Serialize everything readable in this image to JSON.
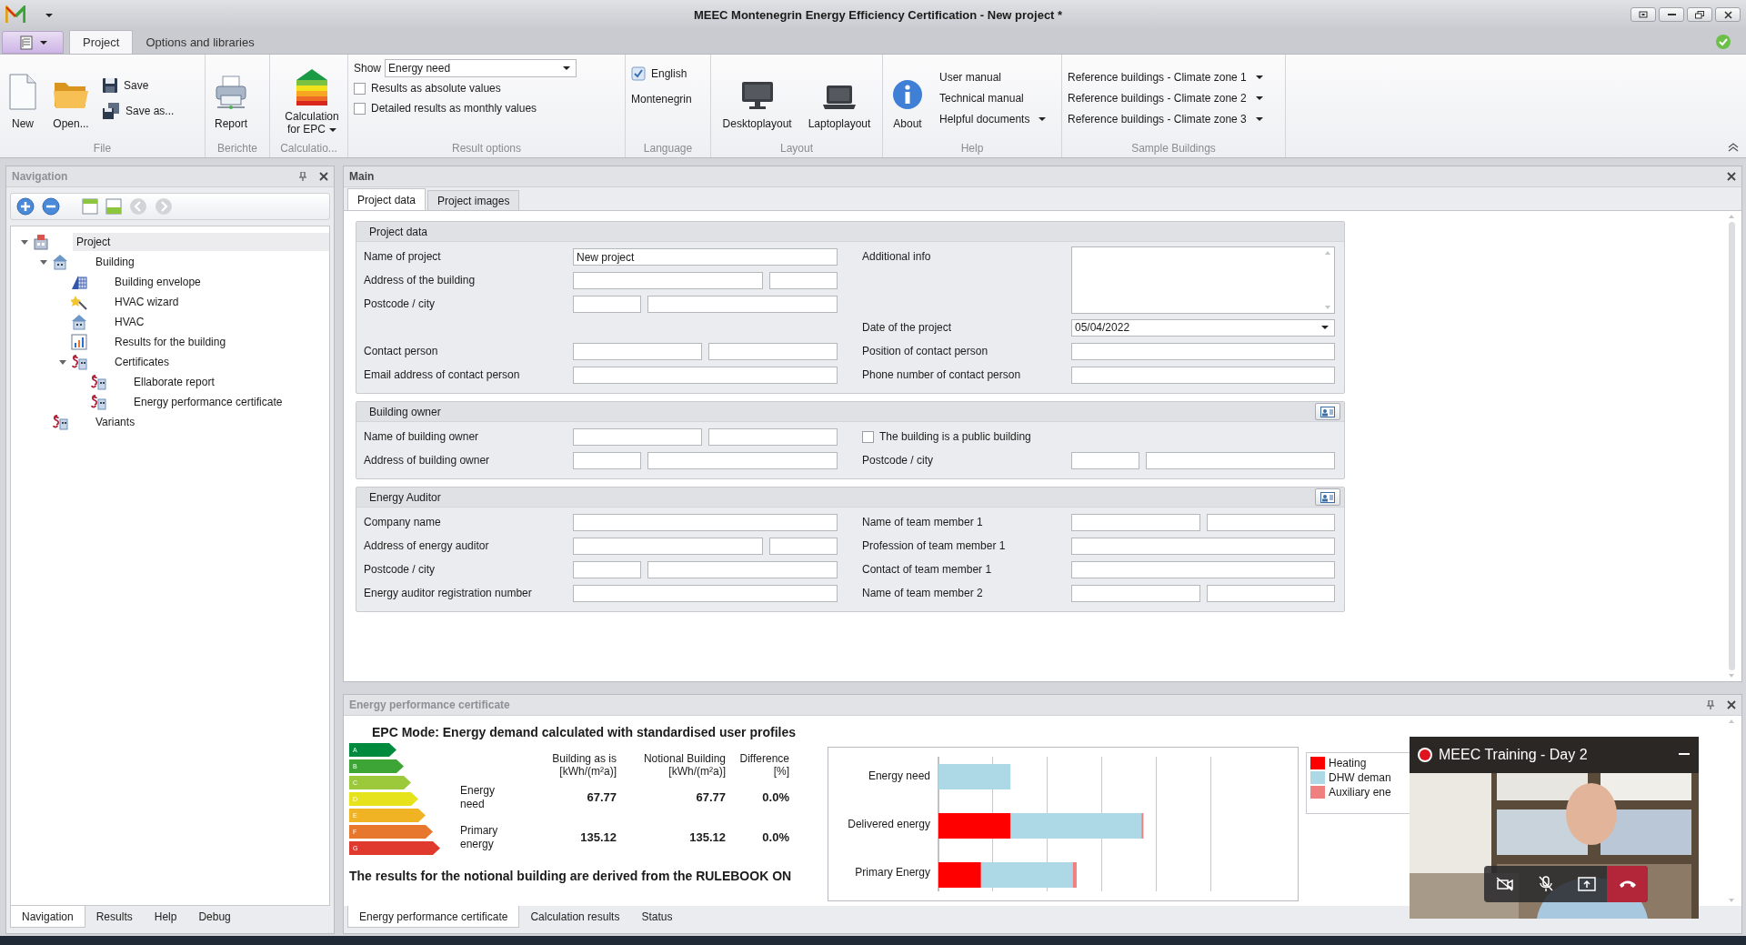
{
  "window": {
    "title": "MEEC Montenegrin Energy Efficiency Certification - New project *"
  },
  "ribbon_tabs": [
    {
      "label": "Project",
      "selected": true
    },
    {
      "label": "Options and libraries",
      "selected": false
    }
  ],
  "ribbon": {
    "file": {
      "label": "File",
      "new": "New",
      "open": "Open...",
      "save": "Save",
      "save_as": "Save as..."
    },
    "reports": {
      "label": "Berichte",
      "report": "Report"
    },
    "calculation": {
      "label": "Calculatio...",
      "button": "Calculation for EPC"
    },
    "result_options": {
      "label": "Result options",
      "show_label": "Show",
      "show_value": "Energy need",
      "checkboxes": [
        {
          "label": "Results as absolute values",
          "checked": false
        },
        {
          "label": "Detailed results as monthly values",
          "checked": false
        }
      ]
    },
    "language": {
      "label": "Language",
      "options": [
        {
          "label": "English",
          "selected": true
        },
        {
          "label": "Montenegrin",
          "selected": false
        }
      ]
    },
    "layout": {
      "label": "Layout",
      "desktop": "Desktoplayout",
      "laptop": "Laptoplayout"
    },
    "help": {
      "label": "Help",
      "about": "About",
      "links": [
        {
          "label": "User manual",
          "menu": false
        },
        {
          "label": "Technical manual",
          "menu": false
        },
        {
          "label": "Helpful documents",
          "menu": true
        }
      ]
    },
    "sample_buildings": {
      "label": "Sample Buildings",
      "items": [
        {
          "label": "Reference buildings - Climate zone 1",
          "menu": true
        },
        {
          "label": "Reference buildings - Climate zone 2",
          "menu": true
        },
        {
          "label": "Reference buildings - Climate zone 3",
          "menu": true
        }
      ]
    }
  },
  "navigation": {
    "title": "Navigation",
    "tree": [
      {
        "label": "Project",
        "selected": true,
        "expanded": true,
        "children": [
          {
            "label": "Building",
            "selected": false,
            "expanded": true,
            "children": [
              {
                "label": "Building envelope",
                "selected": false
              },
              {
                "label": "HVAC wizard",
                "selected": false
              },
              {
                "label": "HVAC",
                "selected": false
              },
              {
                "label": "Results for the building",
                "selected": false
              },
              {
                "label": "Certificates",
                "selected": false,
                "expanded": true,
                "children": [
                  {
                    "label": "Ellaborate report",
                    "selected": false
                  },
                  {
                    "label": "Energy performance certificate",
                    "selected": false
                  }
                ]
              }
            ]
          },
          {
            "label": "Variants",
            "selected": false
          }
        ]
      }
    ],
    "tabs": [
      {
        "label": "Navigation",
        "selected": true
      },
      {
        "label": "Results",
        "selected": false
      },
      {
        "label": "Help",
        "selected": false
      },
      {
        "label": "Debug",
        "selected": false
      }
    ]
  },
  "main_panel": {
    "title": "Main",
    "tabs": [
      {
        "label": "Project data",
        "selected": true
      },
      {
        "label": "Project images",
        "selected": false
      }
    ],
    "sections": [
      {
        "title": "Project data",
        "card_button": false,
        "rows": [
          {
            "left": {
              "label": "Name of project",
              "kind": "single",
              "value": "New project"
            },
            "right": {
              "label": "Additional info",
              "kind": "textarea"
            }
          },
          {
            "left": {
              "label": "Address of the building",
              "kind": "wide-narrow"
            }
          },
          {
            "left": {
              "label": "Postcode / city",
              "kind": "narrow-wide"
            }
          },
          {
            "right": {
              "label": "Date of the project",
              "kind": "date",
              "value": "05/04/2022"
            }
          },
          {
            "left": {
              "label": "Contact person",
              "kind": "pair"
            },
            "right": {
              "label": "Position of contact person",
              "kind": "single"
            }
          },
          {
            "left": {
              "label": "Email address of contact person",
              "kind": "single"
            },
            "right": {
              "label": "Phone number of contact person",
              "kind": "single"
            }
          }
        ]
      },
      {
        "title": "Building owner",
        "card_button": true,
        "rows": [
          {
            "left": {
              "label": "Name of building owner",
              "kind": "pair"
            },
            "right": {
              "label": "The building is a public building",
              "kind": "checkbox",
              "checked": false
            }
          },
          {
            "left": {
              "label": "Address of building owner",
              "kind": "narrow-wide"
            },
            "right": {
              "label": "Postcode / city",
              "kind": "narrow-wide"
            }
          }
        ]
      },
      {
        "title": "Energy Auditor",
        "card_button": true,
        "rows": [
          {
            "left": {
              "label": "Company name",
              "kind": "single"
            },
            "right": {
              "label": "Name of team member 1",
              "kind": "pair"
            }
          },
          {
            "left": {
              "label": "Address of energy auditor",
              "kind": "wide-narrow"
            },
            "right": {
              "label": "Profession of team member 1",
              "kind": "single"
            }
          },
          {
            "left": {
              "label": "Postcode / city",
              "kind": "narrow-wide"
            },
            "right": {
              "label": "Contact of team member 1",
              "kind": "single"
            }
          },
          {
            "left": {
              "label": "Energy auditor registration number",
              "kind": "single"
            },
            "right": {
              "label": "Name of team member 2",
              "kind": "pair"
            }
          }
        ]
      }
    ]
  },
  "epc_panel": {
    "title": "Energy performance certificate",
    "heading": "EPC Mode: Energy demand calculated with standardised user profiles",
    "classes": [
      {
        "letter": "A",
        "color": "#008a3e"
      },
      {
        "letter": "B",
        "color": "#3ca535"
      },
      {
        "letter": "C",
        "color": "#9cc83c"
      },
      {
        "letter": "D",
        "color": "#e6e31c"
      },
      {
        "letter": "E",
        "color": "#f0b324"
      },
      {
        "letter": "F",
        "color": "#e8772e"
      },
      {
        "letter": "G",
        "color": "#e03a2f"
      }
    ],
    "table": {
      "columns": [
        {
          "label": "Building as is",
          "unit": "[kWh/(m²a)]"
        },
        {
          "label": "Notional Building",
          "unit": "[kWh/(m²a)]"
        },
        {
          "label": "Difference",
          "unit": "[%]"
        }
      ],
      "rows": [
        {
          "label": "Energy need",
          "values": [
            "67.77",
            "67.77",
            "0.0%"
          ]
        },
        {
          "label": "Primary energy",
          "values": [
            "135.12",
            "135.12",
            "0.0%"
          ]
        }
      ]
    },
    "chart": {
      "categories": [
        "Energy need",
        "Delivered energy",
        "Primary Energy"
      ],
      "legend": [
        {
          "label": "Heating",
          "color": "#ff0000"
        },
        {
          "label": "DHW deman",
          "color": "#add8e6"
        },
        {
          "label": "Auxiliary ene",
          "color": "#f08080"
        }
      ]
    },
    "note": "The results for the notional building are derived from the  RULEBOOK ON",
    "tabs": [
      {
        "label": "Energy performance certificate",
        "selected": true
      },
      {
        "label": "Calculation results",
        "selected": false
      },
      {
        "label": "Status",
        "selected": false
      }
    ]
  },
  "video_call": {
    "title": "MEEC Training - Day 2",
    "recording": true
  }
}
